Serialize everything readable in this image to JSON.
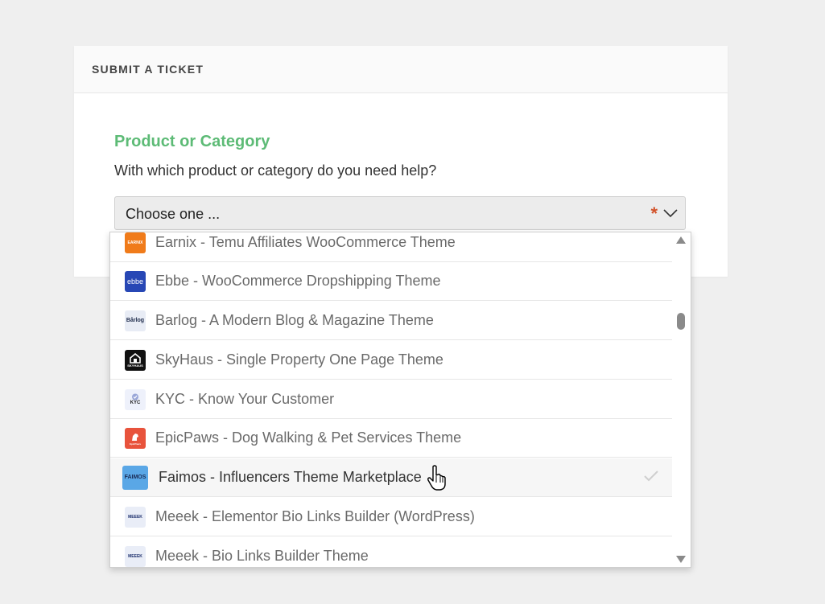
{
  "card": {
    "header_title": "SUBMIT A TICKET",
    "field_title": "Product or Category",
    "field_help": "With which product or category do you need help?"
  },
  "select": {
    "value": "Choose one ...",
    "required_mark": "*"
  },
  "options": [
    {
      "label": "Earnix - Temu Affiliates WooCommerce Theme",
      "icon": "earnix-logo-icon",
      "logo_text": "EARNIX",
      "logo_color": "#f07b1a"
    },
    {
      "label": "Ebbe - WooCommerce Dropshipping Theme",
      "icon": "ebbe-logo-icon",
      "logo_text": "ebbe",
      "logo_color": "#2747b5"
    },
    {
      "label": "Barlog - A Modern Blog & Magazine Theme",
      "icon": "barlog-logo-icon",
      "logo_text": "Bårlog",
      "logo_color": "#e8ecf5"
    },
    {
      "label": "SkyHaus - Single Property One Page Theme",
      "icon": "skyhaus-logo-icon",
      "logo_text": "SKYHAUS",
      "logo_color": "#111111"
    },
    {
      "label": "KYC - Know Your Customer",
      "icon": "kyc-logo-icon",
      "logo_text": "KYC",
      "logo_color": "#eef1fb"
    },
    {
      "label": "EpicPaws - Dog Walking & Pet Services Theme",
      "icon": "epicpaws-logo-icon",
      "logo_text": "EpicPaws",
      "logo_color": "#e8533c"
    },
    {
      "label": "Faimos - Influencers Theme Marketplace",
      "icon": "faimos-logo-icon",
      "logo_text": "FAIMOS",
      "logo_color": "#5aa7e6",
      "hovered": true,
      "selected_check": true
    },
    {
      "label": "Meeek - Elementor Bio Links Builder (WordPress)",
      "icon": "meeek-logo-icon",
      "logo_text": "MEEEK",
      "logo_color": "#e9edf7"
    },
    {
      "label": "Meeek - Bio Links Builder Theme",
      "icon": "meeek-logo-icon",
      "logo_text": "MEEEK",
      "logo_color": "#e9edf7"
    }
  ],
  "colors": {
    "accent_green": "#5dbb76",
    "required_red": "#d2522a",
    "page_bg": "#efefef"
  }
}
